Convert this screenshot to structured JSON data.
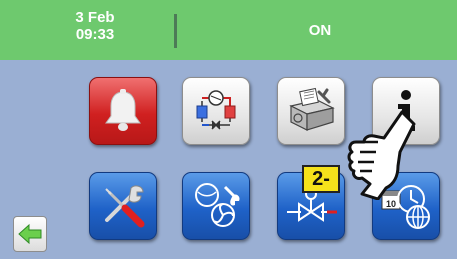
{
  "header": {
    "date": "3 Feb",
    "time": "09:33",
    "status": "ON"
  },
  "tiles": [
    {
      "name": "alarm-bell-button",
      "icon": "bell-icon"
    },
    {
      "name": "refrigeration-circuit-button",
      "icon": "refrigeration-circuit-icon"
    },
    {
      "name": "unit-maintenance-button",
      "icon": "unit-tools-icon"
    },
    {
      "name": "info-button",
      "icon": "info-icon"
    },
    {
      "name": "service-tools-button",
      "icon": "screwdriver-wrench-icon"
    },
    {
      "name": "compressor-fan-service-button",
      "icon": "compressor-fan-wrench-icon"
    },
    {
      "name": "valve-settings-button",
      "icon": "valve-icon"
    },
    {
      "name": "clock-network-button",
      "icon": "calendar-clock-globe-icon"
    }
  ],
  "callout": {
    "label": "2-"
  },
  "colors": {
    "header": "#6ec96e",
    "background": "#9aafd3",
    "alarm_red": "#d02020",
    "tile_blue": "#1f62c8",
    "badge_yellow": "#f5e21b"
  }
}
